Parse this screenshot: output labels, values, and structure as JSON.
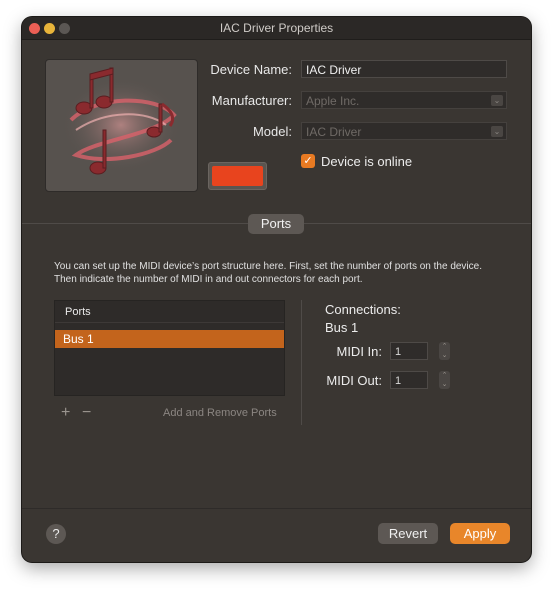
{
  "window": {
    "title": "IAC Driver Properties"
  },
  "device": {
    "name_label": "Device Name:",
    "name_value": "IAC Driver",
    "manufacturer_label": "Manufacturer:",
    "manufacturer_value": "Apple Inc.",
    "model_label": "Model:",
    "model_value": "IAC Driver",
    "online_label": "Device is online",
    "online_checked": true,
    "icon": "midi-notes-icon",
    "color": "#e8441e"
  },
  "ports_tab": {
    "label": "Ports"
  },
  "description": "You can set up the MIDI device’s port structure here. First, set the number of ports on the device. Then indicate the number of MIDI in and out connectors for each port.",
  "ports_table": {
    "header": "Ports",
    "rows": [
      "Bus 1"
    ],
    "selected": "Bus 1"
  },
  "port_controls": {
    "add_symbol": "+",
    "remove_symbol": "−",
    "caption": "Add and Remove Ports"
  },
  "connections": {
    "title": "Connections:",
    "bus": "Bus 1",
    "midi_in_label": "MIDI In:",
    "midi_in_value": "1",
    "midi_out_label": "MIDI Out:",
    "midi_out_value": "1"
  },
  "footer": {
    "help_symbol": "?",
    "revert_label": "Revert",
    "apply_label": "Apply"
  },
  "colors": {
    "accent": "#e8862a",
    "selection": "#c3641c",
    "window_bg": "#3a3632"
  }
}
